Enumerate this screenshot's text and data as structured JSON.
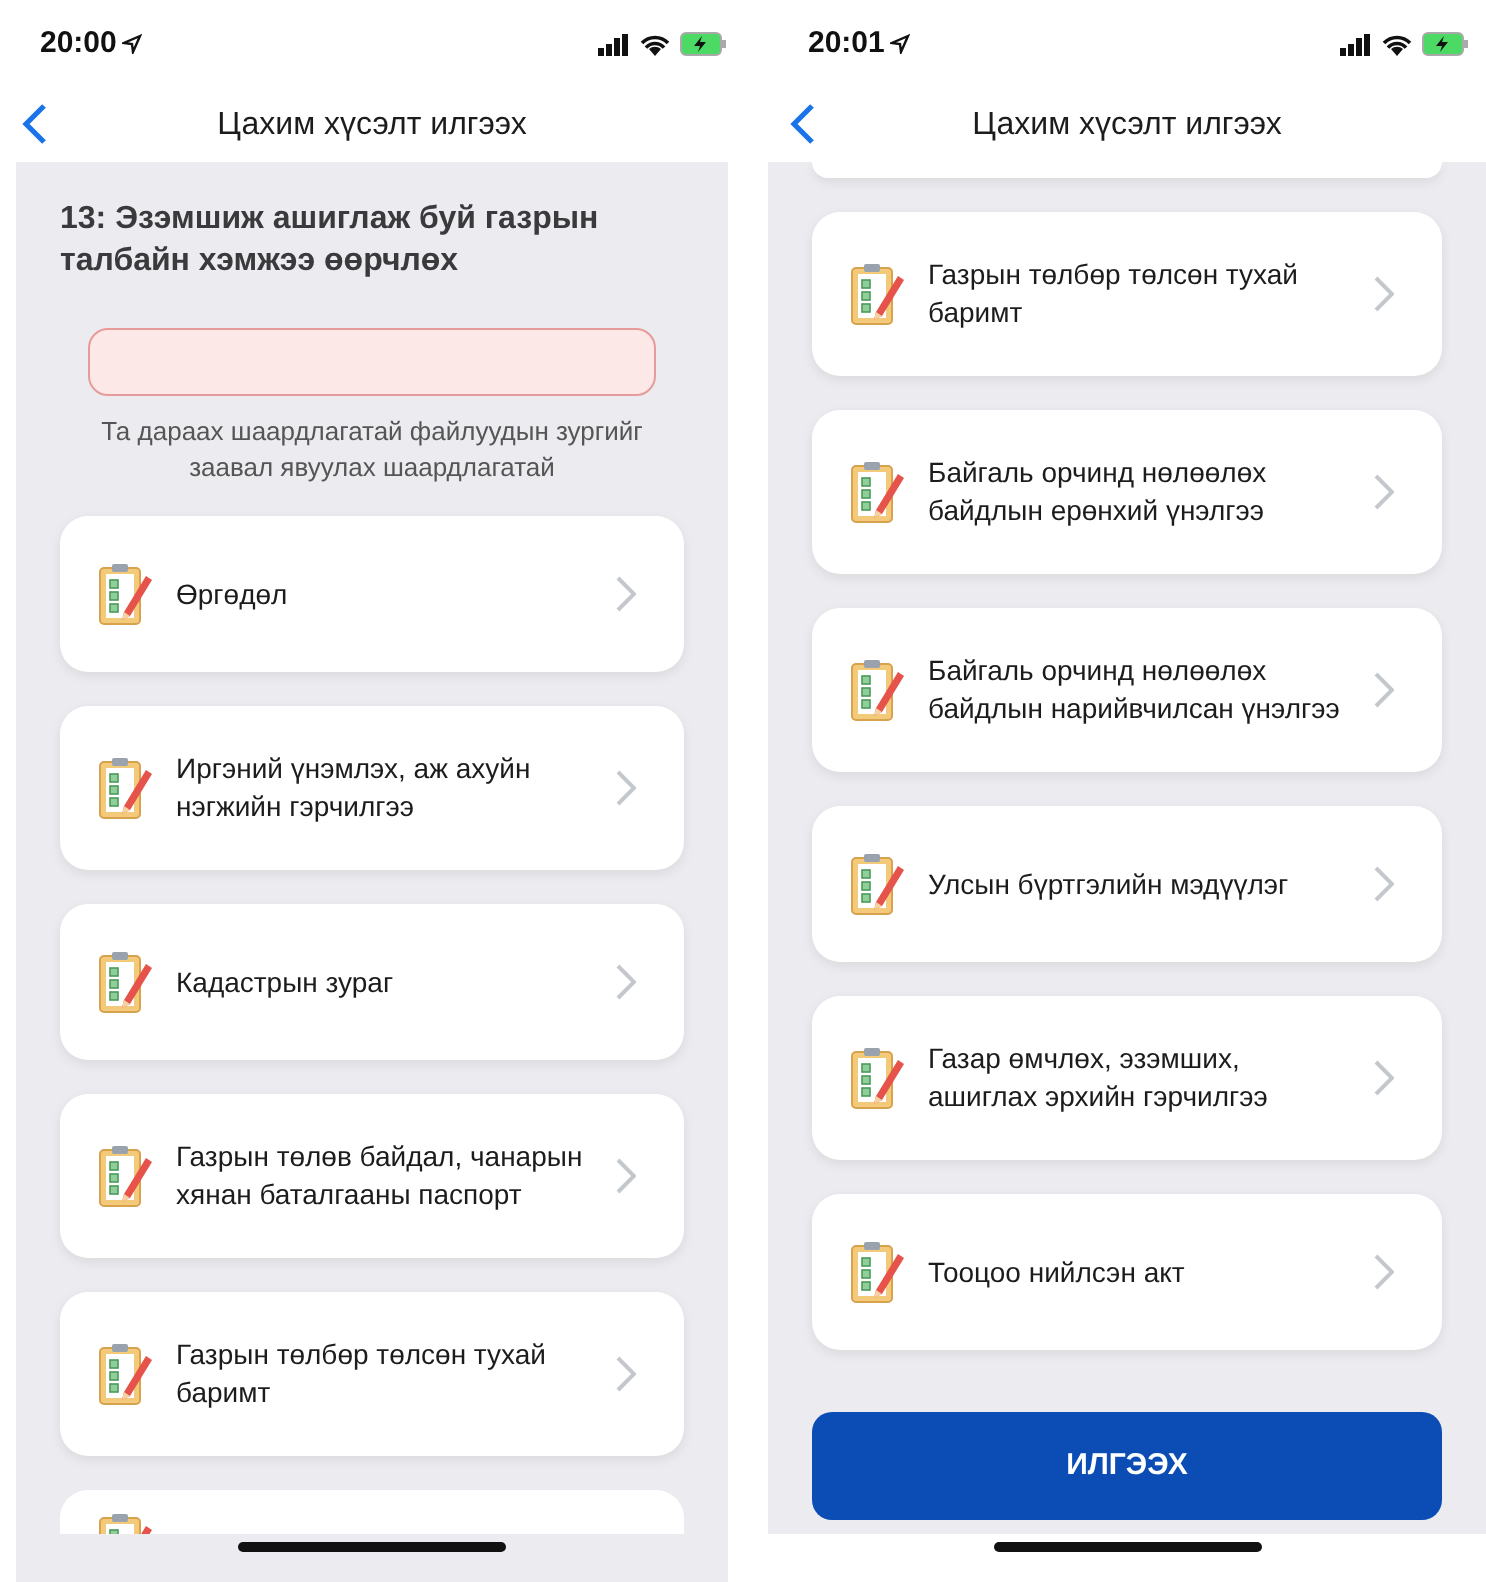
{
  "screens": [
    {
      "status_bar": {
        "time": "20:00"
      },
      "title": "Цахим хүсэлт илгээх",
      "heading": "13: Эзэмшиж ашиглаж буй газрын талбайн хэмжээ өөрчлөх",
      "error_field": {
        "invalid": true
      },
      "note": "Та дараах шаардлагатай файлуудын зургийг заавал явуулах шаардлагатай",
      "cut_top": false,
      "cut_bottom": true,
      "documents": [
        {
          "label": "Өргөдөл"
        },
        {
          "label": "Иргэний үнэмлэх, аж ахуйн нэгжийн гэрчилгээ"
        },
        {
          "label": "Кадастрын зураг"
        },
        {
          "label": "Газрын төлөв байдал, чанарын хянан баталгааны паспорт"
        },
        {
          "label": "Газрын төлбөр төлсөн тухай баримт"
        }
      ]
    },
    {
      "status_bar": {
        "time": "20:01"
      },
      "title": "Цахим хүсэлт илгээх",
      "cut_top": true,
      "cut_bottom": false,
      "documents": [
        {
          "label": "Газрын төлбөр төлсөн тухай баримт"
        },
        {
          "label": "Байгаль орчинд нөлөөлөх байдлын ерөнхий үнэлгээ"
        },
        {
          "label": "Байгаль орчинд нөлөөлөх байдлын нарийвчилсан үнэлгээ"
        },
        {
          "label": "Улсын бүртгэлийн мэдүүлэг"
        },
        {
          "label": "Газар өмчлөх, эзэмших, ашиглах эрхийн гэрчилгээ"
        },
        {
          "label": "Тооцоо нийлсэн акт"
        }
      ],
      "submit_button": "ИЛГЭЭХ"
    }
  ]
}
